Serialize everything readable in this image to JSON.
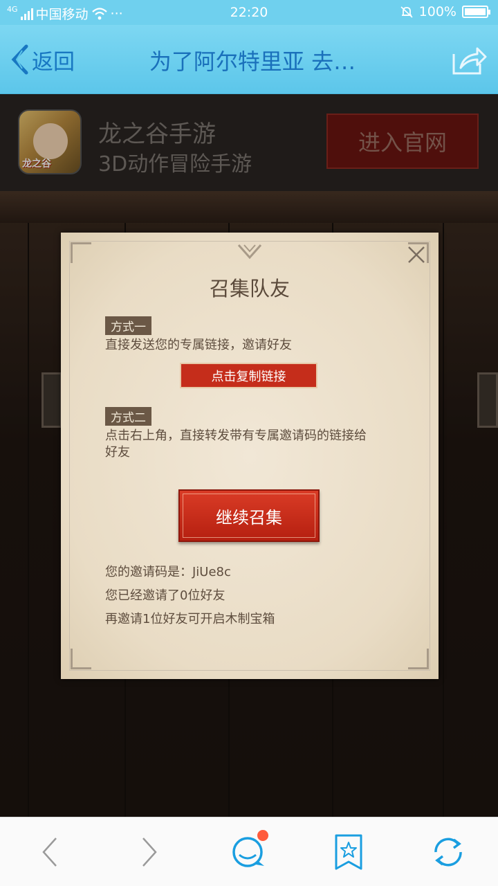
{
  "status_bar": {
    "network": "4G",
    "carrier": "中国移动",
    "more": "···",
    "time": "22:20",
    "battery": "100%"
  },
  "nav": {
    "back_label": "返回",
    "title": "为了阿尔特里亚 去…"
  },
  "ad": {
    "icon_text": "龙之谷",
    "title": "龙之谷手游",
    "subtitle": "3D动作冒险手游",
    "button_label": "进入官网"
  },
  "modal": {
    "title": "召集队友",
    "method1": {
      "tag": "方式一",
      "desc": "直接发送您的专属链接，邀请好友",
      "button_label": "点击复制链接"
    },
    "method2": {
      "tag": "方式二",
      "desc": "点击右上角，直接转发带有专属邀请码的链接给好友"
    },
    "continue_label": "继续召集",
    "invite_code": "您的邀请码是：JiUe8c",
    "invited_count": "您已经邀请了0位好友",
    "reward_hint": "再邀请1位好友可开启木制宝箱"
  },
  "colors": {
    "accent_blue": "#1877c2",
    "nav_bg": "#6fd0ee",
    "button_red": "#c52d1b",
    "parchment": "#ede1cc"
  }
}
